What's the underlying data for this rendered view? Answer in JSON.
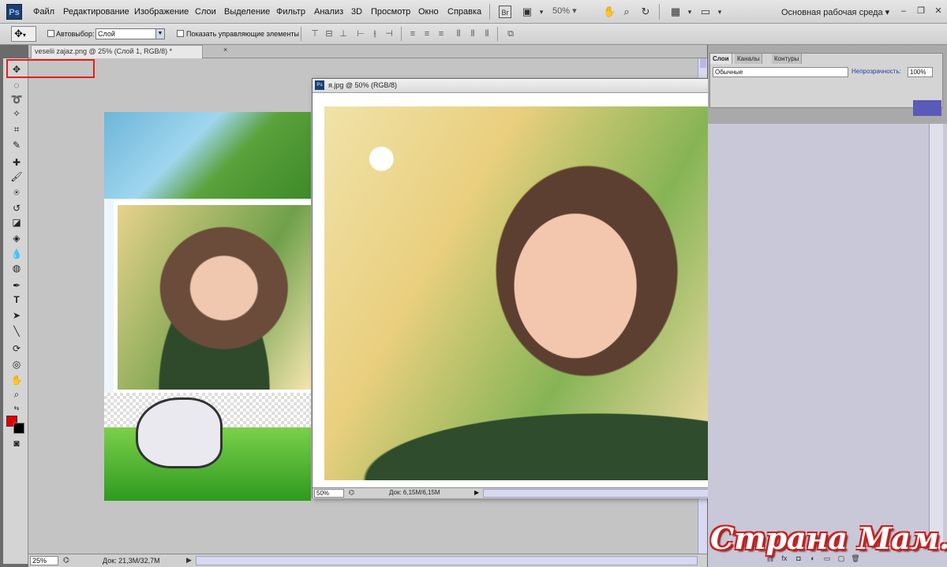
{
  "app": {
    "logo": "Ps"
  },
  "menu": [
    "Файл",
    "Редактирование",
    "Изображение",
    "Слои",
    "Выделение",
    "Фильтр",
    "Анализ",
    "3D",
    "Просмотр",
    "Окно",
    "Справка"
  ],
  "appbar": {
    "bridge": "Br",
    "zoom": "50%",
    "workspace": "Основная рабочая среда ▾"
  },
  "options": {
    "autoselect_label": "Автовыбор:",
    "autoselect_value": "Слой",
    "show_controls_label": "Показать управляющие элементы"
  },
  "main_doc": {
    "tab_title": "veselii zajaz.png @ 25% (Слой 1, RGB/8) *",
    "zoom": "25%",
    "doc_size": "Док: 21,3M/32,7M"
  },
  "float_doc": {
    "title": "я.jpg @ 50% (RGB/8)",
    "zoom": "50%",
    "doc_size": "Док: 6,15M/6,15M"
  },
  "panels": {
    "tabs": [
      "Слои",
      "Каналы",
      "Контуры"
    ],
    "blend_mode": "Обычные",
    "opacity_label": "Непрозрачность:",
    "opacity_value": "100%"
  },
  "watermark": "Страна Мам.ру",
  "colors": {
    "foreground": "#e60000",
    "background": "#000000",
    "highlight": "#e02020"
  },
  "icons": [
    "move-tool-icon",
    "lasso-icon",
    "magic-wand-icon",
    "crop-icon",
    "eyedropper-icon",
    "healing-brush-icon",
    "brush-icon",
    "clone-stamp-icon",
    "history-brush-icon",
    "eraser-icon",
    "paint-bucket-icon",
    "blur-icon",
    "dodge-icon",
    "pen-icon",
    "type-icon",
    "path-select-icon",
    "line-icon",
    "3d-rotate-icon",
    "3d-orbit-icon",
    "hand-icon",
    "zoom-icon"
  ]
}
